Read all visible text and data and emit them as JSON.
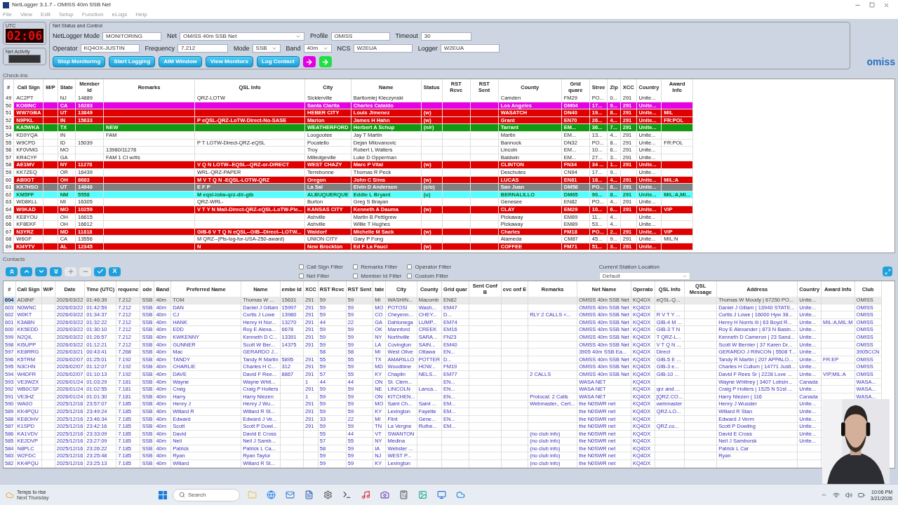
{
  "window": {
    "title": "NetLogger 3.1.7 - OMISS 40m SSB Net"
  },
  "menu": [
    "File",
    "View",
    "Edit",
    "Setup",
    "Function",
    "eLogs",
    "Help"
  ],
  "clock": {
    "label": "UTC",
    "time": "02:06"
  },
  "net_activity": {
    "label": "Net Activity"
  },
  "net_status": {
    "title": "Net Status and Control",
    "row1": [
      {
        "label": "NetLogger Mode",
        "value": "MONITORING",
        "kind": "text"
      },
      {
        "label": "Net",
        "value": "OMISS 40m SSB Net",
        "kind": "select"
      },
      {
        "label": "Profile",
        "value": "OMISS",
        "kind": "text"
      },
      {
        "label": "Timeout",
        "value": "30",
        "kind": "short"
      }
    ],
    "row2": [
      {
        "label": "Operator",
        "value": "KQ4OX-JUSTIN",
        "kind": "text"
      },
      {
        "label": "Frequency",
        "value": "7.212",
        "kind": "short"
      },
      {
        "label": "Mode",
        "value": "SSB",
        "kind": "select"
      },
      {
        "label": "Band",
        "value": "40m",
        "kind": "select"
      },
      {
        "label": "NCS",
        "value": "W2EUA",
        "kind": "text"
      },
      {
        "label": "Logger",
        "value": "W2EUA",
        "kind": "text"
      }
    ],
    "buttons": [
      "Stop Monitoring",
      "Start Logging",
      "AIM Window",
      "View Monitors",
      "Log Contact"
    ],
    "arrows": [
      {
        "color": "#e000e0"
      },
      {
        "color": "#22dd44"
      }
    ]
  },
  "logo": "omiss",
  "checkins": {
    "title": "Check-ins",
    "columns": [
      "#",
      "Call Sign",
      "M/P",
      "State",
      "Member Id",
      "Remarks",
      "QSL Info",
      "City",
      "Name",
      "Status",
      "RST Rcvc",
      "RST Sent",
      "County",
      "Grid quare",
      "Stree",
      "Zip",
      "XCC",
      "Country",
      "Award Info"
    ],
    "rows": [
      {
        "color": "#ffffff",
        "cells": [
          "49",
          "AC2PT",
          "",
          "NJ",
          "14889",
          "",
          "QRZ-LOTW",
          "Sicklerville",
          "Bartlomiej Kleczynski",
          "",
          "",
          "",
          "Camden",
          "FM29",
          "PO...",
          "0...",
          "291",
          "Unite...",
          ""
        ]
      },
      {
        "color": "#e600e6",
        "cells": [
          "50",
          "KO6INC",
          "",
          "CA",
          "16283",
          "",
          "",
          "Santa Clarita",
          "Charles Cataldo",
          "",
          "",
          "",
          "Los Angeles",
          "DM04",
          "17...",
          "9...",
          "291",
          "Unite...",
          ""
        ]
      },
      {
        "color": "#e00000",
        "cells": [
          "51",
          "WW7GBA",
          "",
          "UT",
          "13849",
          "",
          "",
          "HEBER CITY",
          "Louis Jimenez",
          "(w)",
          "",
          "",
          "WASATCH",
          "DN40",
          "19...",
          "8...",
          "291",
          "Unite...",
          "MIL"
        ]
      },
      {
        "color": "#e00000",
        "cells": [
          "52",
          "N9PKL",
          "",
          "IN",
          "15633",
          "",
          "P eQSL-QRZ-LoTW-Direct-No-SASE",
          "Marion",
          "James H Hahn",
          "(w)",
          "",
          "",
          "Grant",
          "EN70",
          "26...",
          "4...",
          "291",
          "Unite...",
          "FR:POL"
        ]
      },
      {
        "color": "#119911",
        "cells": [
          "53",
          "KA5WKA",
          "",
          "TX",
          "",
          "NEW",
          "",
          "WEATHERFORD",
          "Herbert A Schup",
          "(n/r)",
          "",
          "",
          "Tarrant",
          "EM...",
          "36...",
          "7...",
          "291",
          "Unite...",
          ""
        ]
      },
      {
        "color": "#ffffff",
        "cells": [
          "54",
          "KD9YQA",
          "",
          "IN",
          "",
          "FAM",
          "",
          "Loogootee",
          "Jay T Martin",
          "",
          "",
          "",
          "Martin",
          "EM...",
          "13...",
          "4...",
          "291",
          "Unite...",
          ""
        ]
      },
      {
        "color": "#ffffff",
        "cells": [
          "55",
          "W9CPD",
          "",
          "ID",
          "15039",
          "",
          "P T LOTW-Direct-QRZ-eQSL",
          "Pocatello",
          "Dejan Milovanovic",
          "",
          "",
          "",
          "Bannock",
          "DN32",
          "PO...",
          "8...",
          "291",
          "Unite...",
          "FR:POL"
        ]
      },
      {
        "color": "#ffffff",
        "cells": [
          "56",
          "KF0VMG",
          "",
          "MO",
          "",
          "13980/11278",
          "",
          "Troy",
          "Robert L Walters",
          "",
          "",
          "",
          "Lincoln",
          "EM...",
          "10...",
          "6...",
          "291",
          "Unite...",
          ""
        ]
      },
      {
        "color": "#ffffff",
        "cells": [
          "57",
          "KR4CYF",
          "",
          "GA",
          "",
          "FAM 1 CI w/#s",
          "",
          "Milledgeville",
          "Luke D Opperman",
          "",
          "",
          "",
          "Baldwin",
          "EM...",
          "27...",
          "3...",
          "291",
          "Unite...",
          ""
        ]
      },
      {
        "color": "#e00000",
        "cells": [
          "58",
          "AE1MV",
          "",
          "NY",
          "11278",
          "",
          "V Q N LOTW--EQSL--QRZ-or-DIRECT",
          "WEST CHAZY",
          "Marc P Vital",
          "(w)",
          "",
          "",
          "CLINTON",
          "FN34",
          "34 ...",
          "1...",
          "291",
          "Unite...",
          ""
        ]
      },
      {
        "color": "#ffffff",
        "cells": [
          "59",
          "KK7ZEQ",
          "",
          "OR",
          "16439",
          "",
          "WRL-QRZ-PAPER",
          "Terrebonne",
          "Thomas R Peck",
          "",
          "",
          "",
          "Deschutes",
          "CN94",
          "17...",
          "9...",
          "",
          "Unite...",
          ""
        ]
      },
      {
        "color": "#e00000",
        "cells": [
          "60",
          "AB0GT",
          "",
          "OH",
          "8683",
          "",
          "M V T Q N -EQSL-LOTW-QRZ",
          "Oregon",
          "John C Sims",
          "(w)",
          "",
          "",
          "LUCAS",
          "EN81",
          "18...",
          "4...",
          "291",
          "Unite...",
          "MIL:A"
        ]
      },
      {
        "color": "#808080",
        "cells": [
          "61",
          "KK7HSO",
          "",
          "UT",
          "14940",
          "",
          "E F P",
          "La Sal",
          "Elvin D Anderson",
          "(c/o)",
          "",
          "",
          "San Juan",
          "DM58",
          "PO...",
          "8...",
          "291",
          "Unite...",
          ""
        ]
      },
      {
        "color": "#55ffff",
        "cells": [
          "62",
          "KM5FF",
          "",
          "NM",
          "5558",
          "",
          "M eqsl-lotw-qrz-dir-gib",
          "ALBUQUERQUE",
          "Eddie L Bryant",
          "(u)",
          "",
          "",
          "BERNALILLO",
          "DM65",
          "90...",
          "8...",
          "291",
          "Unite...",
          "MIL:A,MI..."
        ]
      },
      {
        "color": "#ffffff",
        "cells": [
          "63",
          "WD8KLL",
          "",
          "MI",
          "16305",
          "",
          "QRZ-WRL-",
          "Burton",
          "Greg S Brayan",
          "",
          "",
          "",
          "Genesee",
          "EN82",
          "PO...",
          "4...",
          "291",
          "Unite...",
          ""
        ]
      },
      {
        "color": "#e00000",
        "cells": [
          "64",
          "W0KAD",
          "",
          "MO",
          "10259",
          "",
          "V T Y N Mail-Direct-QRZ-eQSL-LoTW-Ple...",
          "KANSAS CITY",
          "Kenneth A Dauma",
          "(w)",
          "",
          "",
          "CLAY",
          "EM29",
          "10...",
          "6...",
          "291",
          "Unite...",
          "VIP"
        ]
      },
      {
        "color": "#ffffff",
        "cells": [
          "65",
          "KE8YOU",
          "",
          "OH",
          "16615",
          "",
          "",
          "Ashville",
          "Martin B Pettigrew",
          "",
          "",
          "",
          "Pickaway",
          "EM89",
          "11...",
          "4...",
          "",
          "Unite...",
          ""
        ]
      },
      {
        "color": "#ffffff",
        "cells": [
          "66",
          "KF8EKF",
          "",
          "OH",
          "16612",
          "",
          "",
          "Ashville",
          "Willie T Hughes",
          "",
          "",
          "",
          "Pickaway",
          "EM89",
          "53...",
          "4...",
          "",
          "Unite...",
          ""
        ]
      },
      {
        "color": "#e00000",
        "cells": [
          "67",
          "N3YRZ",
          "",
          "MD",
          "11818",
          "",
          "GIB-6 V T Q N eQSL--GIB--Direct--LOTW...",
          "Waldorf",
          "Michelle M Sack",
          "(w)",
          "",
          "",
          "Charles",
          "FM18",
          "PO...",
          "2...",
          "291",
          "Unite...",
          "VIP"
        ]
      },
      {
        "color": "#ffffff",
        "cells": [
          "68",
          "W6GF",
          "",
          "CA",
          "13556",
          "",
          "M QRZ--(Pls-log-for-USA-250-award)",
          "UNION CITY",
          "Gary P Fong",
          "",
          "",
          "",
          "Alameda",
          "CM87",
          "45...",
          "9...",
          "291",
          "Unite...",
          "MIL:N"
        ]
      },
      {
        "color": "#e00000",
        "cells": [
          "69",
          "KI4YTV",
          "",
          "AL",
          "12345",
          "",
          "N",
          "New Brockton",
          "Ed F La Fauci",
          "(w)",
          "",
          "",
          "COFFEE",
          "FM71",
          "51...",
          "3...",
          "291",
          "Unite...",
          ""
        ]
      }
    ]
  },
  "contacts": {
    "title": "Contacts",
    "toolbar": [
      {
        "kind": "first",
        "disabled": false
      },
      {
        "kind": "up",
        "disabled": false
      },
      {
        "kind": "down",
        "disabled": false
      },
      {
        "kind": "last",
        "disabled": false
      },
      {
        "kind": "add",
        "disabled": true
      },
      {
        "kind": "remove",
        "disabled": true
      },
      {
        "kind": "confirm",
        "disabled": false
      },
      {
        "kind": "cancel",
        "disabled": false,
        "label": "X"
      }
    ],
    "filters": [
      {
        "label": "Call Sign Filter",
        "checked": false
      },
      {
        "label": "Remarks Filter",
        "checked": false
      },
      {
        "label": "Operator Filter",
        "checked": false
      },
      {
        "label": "Net Filter",
        "checked": false
      },
      {
        "label": "Member Id Filter",
        "checked": false
      },
      {
        "label": "Custom Filter",
        "checked": false
      }
    ],
    "station_location": {
      "label": "Current Station Location",
      "value": "Default"
    },
    "columns": [
      "#",
      "Call Sign",
      "W/P",
      "Date",
      "Time (UTC)",
      "requenc",
      "ode",
      "Band",
      "Preferred Name",
      "Name",
      "embe Id",
      "XCC",
      "RST Rcvc",
      "RST Sent",
      "tate",
      "City",
      "County",
      "Grid quar",
      "Sent Conf B",
      "cvc onf E",
      "Remarks",
      "Net Name",
      "Operato",
      "QSL Info",
      "QSL Message",
      "Address",
      "Country",
      "Award Info",
      "Club"
    ],
    "rows": [
      {
        "selected": true,
        "cells": [
          "604",
          "AD8NF",
          "",
          "2026/03/22",
          "01:46:39",
          "7.212",
          "SSB",
          "40m",
          "TOM",
          "Thomas W ...",
          "15631",
          "291",
          "59",
          "59",
          "MI",
          "WASHIN...",
          "Macomb",
          "EN82",
          "",
          "",
          "",
          "OMISS 40m SSB Net",
          "KQ4DX",
          "eQSL-Q...",
          "",
          "Thomas W Moody | 67250 PO...",
          "Unite...",
          "",
          "OMISS"
        ]
      },
      {
        "selected": false,
        "cells": [
          "603",
          "N0WNC",
          "",
          "2026/03/22",
          "01:42:59",
          "7.212",
          "SSB",
          "40m",
          "DAN",
          "Daniel J Gillam",
          "15997",
          "291",
          "59",
          "59",
          "MO",
          "POTOSI",
          "Wash...",
          "EM47",
          "",
          "",
          "",
          "OMISS 40m SSB Net",
          "KQ4DX",
          "",
          "",
          "Daniel J Gillam | 13940 STATE...",
          "Unite...",
          "",
          "OMISS"
        ]
      },
      {
        "selected": false,
        "cells": [
          "602",
          "W0KT",
          "",
          "2026/03/22",
          "01:34:37",
          "7.212",
          "SSB",
          "40m",
          "CJ",
          "Curtis J Lowe",
          "13980",
          "291",
          "59",
          "59",
          "CO",
          "Cheyenn...",
          "CHEY...",
          "D...",
          "",
          "",
          "RLY 2 CALLS  <...",
          "OMISS 40m SSB Net",
          "KQ4DX",
          "R V T Y ...",
          "",
          "Curtis J Lowe | 16000 Hyw 38...",
          "Unite...",
          "",
          "OMISS"
        ]
      },
      {
        "selected": false,
        "cells": [
          "601",
          "K3ABN",
          "",
          "2026/03/22",
          "01:32:22",
          "7.212",
          "SSB",
          "40m",
          "HANK",
          "Henry H Nor...",
          "13270",
          "291",
          "44",
          "22",
          "GA",
          "Dahlonega",
          "LUMP...",
          "EM74",
          "",
          "",
          "",
          "OMISS 40m SSB Net",
          "KQ4DX",
          "GIB-4 M ...",
          "",
          "Henry H Norris Iii | 63 Boyd R...",
          "Unite...",
          "MIL:A,MIL:M",
          "OMISS"
        ]
      },
      {
        "selected": false,
        "cells": [
          "600",
          "KK5EDD",
          "",
          "2026/03/22",
          "01:30:10",
          "7.212",
          "SSB",
          "40m",
          "EDD",
          "Roy E Alexa...",
          "6678",
          "291",
          "59",
          "59",
          "OK",
          "Mannford",
          "CREEK",
          "EM16",
          "",
          "",
          "",
          "OMISS 40m SSB Net",
          "KQ4DX",
          "GIB-3 T N",
          "",
          "Roy E Alexander | 873 N Basin...",
          "Unite...",
          "",
          "OMISS"
        ]
      },
      {
        "selected": false,
        "cells": [
          "599",
          "N2QIL",
          "",
          "2026/03/22",
          "01:26:57",
          "7.212",
          "SSB",
          "40m",
          "KWKENNY",
          "Kenneth D C...",
          "13391",
          "291",
          "59",
          "59",
          "NY",
          "Northville",
          "SARA...",
          "FN23",
          "",
          "",
          "",
          "OMISS 40m SSB Net",
          "KQ4DX",
          "T QRZ-L...",
          "",
          "Kenneth D Cameron | 23 Sand...",
          "Unite...",
          "",
          "OMISS"
        ]
      },
      {
        "selected": false,
        "cells": [
          "598",
          "KI5UPP",
          "",
          "2026/03/22",
          "01:12:21",
          "7.212",
          "SSB",
          "40m",
          "GUNNER",
          "Scott W Ber...",
          "14375",
          "291",
          "59",
          "59",
          "LA",
          "Covington",
          "SAIN...",
          "EM40",
          "",
          "",
          "",
          "OMISS 40m SSB Net",
          "KQ4DX",
          "V T Q N ...",
          "",
          "Scott W Bernier | 37 Karen Dr...",
          "Unite...",
          "",
          "OMISS"
        ]
      },
      {
        "selected": false,
        "cells": [
          "597",
          "KE8RRG",
          "",
          "2026/03/21",
          "00:43:41",
          "7.268",
          "SSB",
          "40m",
          "Mac",
          "GERARDO J...",
          "",
          "",
          "58",
          "58",
          "MI",
          "West Olive",
          "Ottawa",
          "EN...",
          "",
          "",
          "",
          "3905 40m SSB Ea...",
          "KQ4DX",
          "Direct",
          "",
          "GERARDO J RINCON | 5508 T...",
          "Unite...",
          "",
          "3905CCN"
        ]
      },
      {
        "selected": false,
        "cells": [
          "596",
          "K5TRM",
          "",
          "2026/02/07",
          "01:25:01",
          "7.192",
          "SSB",
          "40m",
          "TANDY",
          "Tandy R Martin",
          "5895",
          "291",
          "55",
          "55",
          "TX",
          "AMARILLO",
          "POTTER",
          "D...",
          "",
          "",
          "",
          "OMISS 40m SSB Net",
          "KQ4DX",
          "GIB-5 E ...",
          "",
          "Tandy R Martin | 207 APPALO...",
          "Unite...",
          "FR:EP",
          "OMISS"
        ]
      },
      {
        "selected": false,
        "cells": [
          "595",
          "N3CHN",
          "",
          "2026/02/07",
          "01:12:07",
          "7.192",
          "SSB",
          "40m",
          "CHARLIE",
          "Charles H C...",
          "312",
          "291",
          "59",
          "59",
          "MD",
          "Woodbine",
          "HOW...",
          "FM19",
          "",
          "",
          "",
          "OMISS 40m SSB Net",
          "KQ4DX",
          "GIB-3 e...",
          "",
          "Charles H Cullum | 14771 Justi...",
          "Unite...",
          "",
          "OMISS"
        ]
      },
      {
        "selected": false,
        "cells": [
          "594",
          "W4DFR",
          "",
          "2026/02/07",
          "01:10:13",
          "7.192",
          "SSB",
          "40m",
          "DAVE",
          "David F Ree...",
          "8867",
          "291",
          "57",
          "55",
          "KY",
          "Chaplin",
          "NELS...",
          "EM77",
          "",
          "",
          "2 CALLS",
          "OMISS 40m SSB Net",
          "KQ4DX",
          "GIB-10 ...",
          "",
          "David F Rees Sr | 2228 Love ...",
          "Unite...",
          "VIP,MIL:A",
          "OMISS"
        ]
      },
      {
        "selected": false,
        "cells": [
          "593",
          "VE3WZX",
          "",
          "2026/01/24",
          "01:03:29",
          "7.181",
          "SSB",
          "40m",
          "Wayne",
          "Wayne Whit...",
          "",
          "1",
          "44",
          "44",
          "ON",
          "St. Clem...",
          "",
          "EN...",
          "",
          "",
          "",
          "WASA NET",
          "KQ4DX",
          "",
          "",
          "Wayne Whitney | 3407 Lobsin...",
          "Canada",
          "",
          "WASA..."
        ]
      },
      {
        "selected": false,
        "cells": [
          "592",
          "WB0CSF",
          "",
          "2026/01/24",
          "01:02:55",
          "7.181",
          "SSB",
          "40m",
          "Craig",
          "Craig P Hollers",
          "",
          "291",
          "59",
          "59",
          "NE",
          "LINCOLN",
          "Lanca...",
          "EN...",
          "",
          "",
          "",
          "WASA NET",
          "KQ4DX",
          "qrz and ...",
          "",
          "Craig P Hollers | 1525 N 51st ...",
          "Unite...",
          "",
          "WASA..."
        ]
      },
      {
        "selected": false,
        "cells": [
          "591",
          "VE3HZ",
          "",
          "2026/01/24",
          "01:01:30",
          "7.181",
          "SSB",
          "40m",
          "Harry",
          "Harry Niezen",
          "",
          "1",
          "59",
          "59",
          "ON",
          "KITCHEN...",
          "",
          "EN...",
          "",
          "",
          "Protocal: 2 Calls",
          "WASA NET",
          "KQ4DX",
          "[QRZ.CO...",
          "",
          "Harry Niezen | 116",
          "Canada",
          "",
          "WASA..."
        ]
      },
      {
        "selected": false,
        "cells": [
          "590",
          "WA0O",
          "",
          "2025/12/16",
          "23:57:07",
          "7.185",
          "SSB",
          "40m",
          "Henry J",
          "Henry J Wu...",
          "",
          "291",
          "59",
          "59",
          "MO",
          "Saint Ch...",
          "Saint ...",
          "EM...",
          "",
          "",
          "Webmaster,. Cert...",
          "the N0SWR net",
          "KQ4DX",
          "webmaster",
          "",
          "Henry J Wussler",
          "Unite...",
          "",
          ""
        ]
      },
      {
        "selected": false,
        "cells": [
          "589",
          "KK4PQU",
          "",
          "2025/12/16",
          "23:49:24",
          "7.185",
          "SSB",
          "40m",
          "Willard R",
          "Willard R St...",
          "",
          "291",
          "59",
          "59",
          "KY",
          "Lexington",
          "Fayette",
          "EM...",
          "",
          "",
          "",
          "the N0SWR net",
          "KQ4DX",
          "QRZ-LO...",
          "",
          "Willard R Stan",
          "Unite...",
          "",
          ""
        ]
      },
      {
        "selected": false,
        "cells": [
          "588",
          "KE8OHV",
          "",
          "2025/12/16",
          "23:46:34",
          "7.185",
          "SSB",
          "40m",
          "Edward",
          "Edward J Ve...",
          "",
          "291",
          "33",
          "22",
          "MI",
          "Flint",
          "Gene...",
          "EN...",
          "",
          "",
          "",
          "the N0SWR net",
          "KQ4DX",
          "",
          "",
          "Edward J Verm",
          "Unite...",
          "",
          ""
        ]
      },
      {
        "selected": false,
        "cells": [
          "587",
          "K1SPD",
          "",
          "2025/12/16",
          "23:42:16",
          "7.185",
          "SSB",
          "40m",
          "Scott",
          "Scott P Dowl...",
          "",
          "291",
          "59",
          "59",
          "TN",
          "La Vergne",
          "Ruthe...",
          "EM...",
          "",
          "",
          "",
          "the N0SWR net",
          "KQ4DX",
          "QRZ.co...",
          "",
          "Scott P Dowling",
          "Unite...",
          "",
          ""
        ]
      },
      {
        "selected": false,
        "cells": [
          "586",
          "KA1VDV",
          "",
          "2025/12/16",
          "23:33:09",
          "7.185",
          "SSB",
          "40m",
          "David",
          "David E Cross",
          "",
          "",
          "55",
          "44",
          "VT",
          "SWANTON",
          "",
          "",
          "",
          "",
          "(no club info)",
          "the N0SWR net",
          "KQ4DX",
          "",
          "",
          "David E Cross",
          "Unite...",
          "",
          ""
        ]
      },
      {
        "selected": false,
        "cells": [
          "585",
          "KE2DVP",
          "",
          "2025/12/16",
          "23:27:09",
          "7.185",
          "SSB",
          "40m",
          "Neil",
          "Neil J Samb...",
          "",
          "",
          "57",
          "55",
          "NY",
          "Medina",
          "",
          "",
          "",
          "",
          "(no club info)",
          "the N0SWR net",
          "KQ4DX",
          "",
          "",
          "Neil J Samborsk",
          "Unite...",
          "",
          ""
        ]
      },
      {
        "selected": false,
        "cells": [
          "584",
          "N8PLC",
          "",
          "2025/12/16",
          "23:26:22",
          "7.185",
          "SSB",
          "40m",
          "Patrick",
          "Patrick L Ca...",
          "",
          "",
          "58",
          "59",
          "IA",
          "Webster ...",
          "",
          "",
          "",
          "",
          "(no club info)",
          "the N0SWR net",
          "KQ4DX",
          "",
          "",
          "Patrick L Car",
          "",
          "",
          ""
        ]
      },
      {
        "selected": false,
        "cells": [
          "583",
          "W2FDC",
          "",
          "2025/12/16",
          "23:25:48",
          "7.185",
          "SSB",
          "40m",
          "Ryan",
          "Ryan Taylor",
          "",
          "",
          "59",
          "59",
          "NJ",
          "WEST P...",
          "",
          "",
          "",
          "",
          "(no club info)",
          "the N0SWR net",
          "KQ4DX",
          "",
          "",
          "Ryan",
          "",
          "",
          ""
        ]
      },
      {
        "selected": false,
        "cells": [
          "582",
          "KK4PQU",
          "",
          "2025/12/16",
          "23:25:13",
          "7.185",
          "SSB",
          "40m",
          "Willard",
          "Willard R St...",
          "",
          "",
          "59",
          "59",
          "KY",
          "Lexington",
          "",
          "",
          "",
          "",
          "(no club info)",
          "the N0SWR net",
          "KQ4DX",
          "",
          "",
          "",
          "",
          "",
          ""
        ]
      }
    ]
  },
  "webcam": {
    "kind": "picture"
  },
  "taskbar": {
    "weather": {
      "title": "Temps to rise",
      "subtitle": "Next Thursday"
    },
    "search": {
      "placeholder": "Search"
    },
    "time": "10:06 PM",
    "date": "3/21/2026"
  }
}
